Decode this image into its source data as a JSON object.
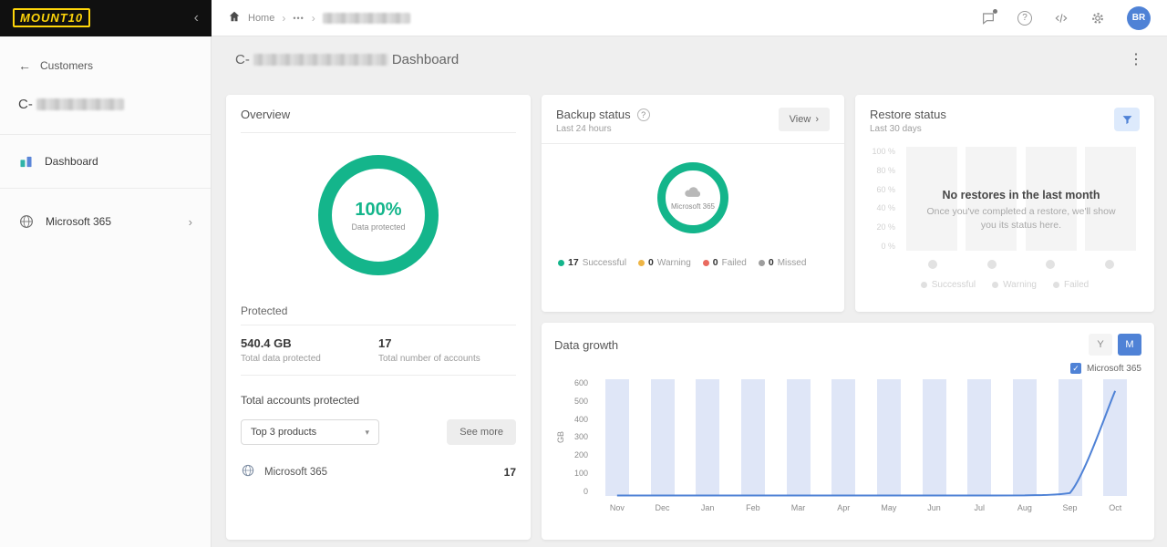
{
  "colors": {
    "green": "#14b58b",
    "blue": "#4f82d6",
    "yellow": "#ffd60a",
    "bar_fill": "#dfe6f7"
  },
  "brand": {
    "logo_text": "MOUNT10"
  },
  "topbar": {
    "breadcrumb": {
      "home": "Home",
      "ellipsis": "•••"
    },
    "avatar_initials": "BR"
  },
  "sidebar": {
    "back_label": "Customers",
    "customer_prefix": "C-",
    "nav": [
      {
        "label": "Dashboard"
      },
      {
        "label": "Microsoft 365"
      }
    ]
  },
  "page": {
    "title_prefix": "C-",
    "title_suffix": "Dashboard"
  },
  "overview": {
    "title": "Overview",
    "donut_percent": "100%",
    "donut_caption": "Data protected",
    "protected_title": "Protected",
    "stats": [
      {
        "value": "540.4 GB",
        "label": "Total data protected"
      },
      {
        "value": "17",
        "label": "Total number of accounts"
      }
    ],
    "accounts_title": "Total accounts protected",
    "products_filter": "Top 3 products",
    "see_more_label": "See more",
    "products": [
      {
        "name": "Microsoft 365",
        "value": "17"
      }
    ]
  },
  "backup": {
    "title": "Backup status",
    "subtitle": "Last 24 hours",
    "view_label": "View",
    "donut_center_label": "Microsoft 365",
    "legend": [
      {
        "count": "17",
        "label": "Successful",
        "color": "#14b58b"
      },
      {
        "count": "0",
        "label": "Warning",
        "color": "#eeb545"
      },
      {
        "count": "0",
        "label": "Failed",
        "color": "#e96a5f"
      },
      {
        "count": "0",
        "label": "Missed",
        "color": "#9e9e9e"
      }
    ]
  },
  "restore": {
    "title": "Restore status",
    "subtitle": "Last 30 days",
    "yticks": [
      "100 %",
      "80 %",
      "60 %",
      "40 %",
      "20 %",
      "0 %"
    ],
    "empty_title": "No restores in the last month",
    "empty_text": "Once you've completed a restore, we'll show you its status here.",
    "legend": [
      "Successful",
      "Warning",
      "Failed"
    ]
  },
  "growth": {
    "title": "Data growth",
    "toggle_year": "Y",
    "toggle_month": "M",
    "series_label": "Microsoft 365",
    "ylabel": "GB"
  },
  "chart_data": [
    {
      "type": "pie",
      "title": "Overview — Data protected",
      "labels": [
        "Data protected"
      ],
      "values": [
        100
      ],
      "center_text": "100%",
      "color": "#14b58b"
    },
    {
      "type": "pie",
      "title": "Backup status — Last 24 hours",
      "labels": [
        "Successful",
        "Warning",
        "Failed",
        "Missed"
      ],
      "values": [
        17,
        0,
        0,
        0
      ],
      "colors": [
        "#14b58b",
        "#eeb545",
        "#e96a5f",
        "#9e9e9e"
      ],
      "center_label": "Microsoft 365"
    },
    {
      "type": "bar",
      "title": "Restore status — Last 30 days",
      "categories": [],
      "values": [],
      "note": "No restores in the last month",
      "ylim": [
        0,
        100
      ],
      "yticks": [
        "100 %",
        "80 %",
        "60 %",
        "40 %",
        "20 %",
        "0 %"
      ]
    },
    {
      "type": "line",
      "title": "Data growth",
      "x": [
        "Nov",
        "Dec",
        "Jan",
        "Feb",
        "Mar",
        "Apr",
        "May",
        "Jun",
        "Jul",
        "Aug",
        "Sep",
        "Oct"
      ],
      "series": [
        {
          "name": "Microsoft 365",
          "values": [
            2,
            2,
            2,
            2,
            2,
            2,
            2,
            2,
            2,
            3,
            15,
            540
          ]
        }
      ],
      "ylabel": "GB",
      "ylim": [
        0,
        600
      ],
      "yticks": [
        "600",
        "500",
        "400",
        "300",
        "200",
        "100",
        "0"
      ],
      "background_columns": "full-height",
      "legend": [
        "Microsoft 365"
      ],
      "legend_position": "top-right"
    }
  ]
}
